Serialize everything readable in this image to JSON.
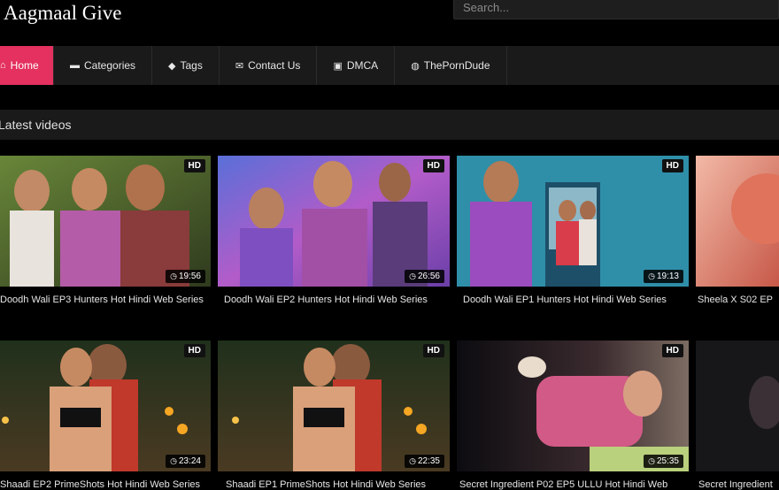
{
  "site": {
    "logo": "Aagmaal Give"
  },
  "search": {
    "placeholder": "Search..."
  },
  "nav": {
    "items": [
      {
        "label": "Home",
        "icon": "home-icon",
        "glyph": "⌂",
        "active": true
      },
      {
        "label": "Categories",
        "icon": "folder-icon",
        "glyph": "▬",
        "active": false
      },
      {
        "label": "Tags",
        "icon": "tag-icon",
        "glyph": "◆",
        "active": false
      },
      {
        "label": "Contact Us",
        "icon": "envelope-icon",
        "glyph": "✉",
        "active": false
      },
      {
        "label": "DMCA",
        "icon": "lock-icon",
        "glyph": "▣",
        "active": false
      },
      {
        "label": "ThePornDude",
        "icon": "globe-icon",
        "glyph": "◍",
        "active": false
      }
    ]
  },
  "section": {
    "title": "Latest videos"
  },
  "videos": [
    {
      "title": "Doodh Wali EP3 Hunters Hot Hindi Web Series",
      "duration": "19:56",
      "badge": "HD"
    },
    {
      "title": "Doodh Wali EP2 Hunters Hot Hindi Web Series",
      "duration": "26:56",
      "badge": "HD"
    },
    {
      "title": "Doodh Wali EP1 Hunters Hot Hindi Web Series",
      "duration": "19:13",
      "badge": "HD"
    },
    {
      "title": "Sheela X S02 EP",
      "duration": "",
      "badge": ""
    },
    {
      "title": "Shaadi EP2 PrimeShots Hot Hindi Web Series",
      "duration": "23:24",
      "badge": "HD"
    },
    {
      "title": "Shaadi EP1 PrimeShots Hot Hindi Web Series",
      "duration": "22:35",
      "badge": "HD"
    },
    {
      "title": "Secret Ingredient P02 EP5 ULLU Hot Hindi Web",
      "duration": "25:35",
      "badge": "HD"
    },
    {
      "title": "Secret Ingredient",
      "duration": "",
      "badge": ""
    }
  ],
  "colors": {
    "accent": "#e4315f",
    "background": "#000000",
    "bar": "#1a1a1a"
  }
}
